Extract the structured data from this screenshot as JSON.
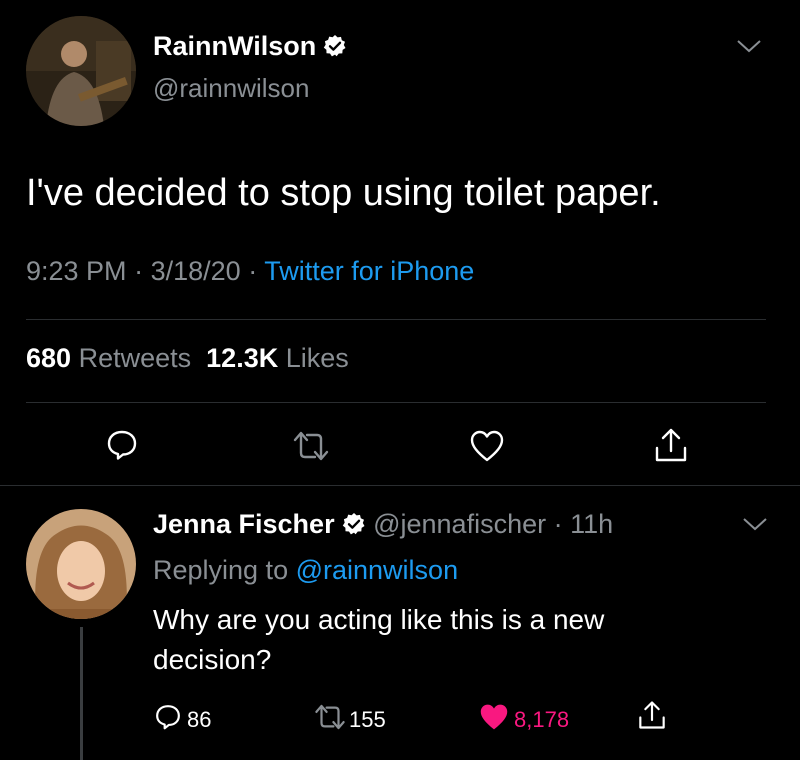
{
  "main_tweet": {
    "display_name": "RainnWilson",
    "handle": "@rainnwilson",
    "text": "I've decided to stop using toilet paper.",
    "time": "9:23 PM",
    "date": "3/18/20",
    "source": "Twitter for iPhone",
    "retweets_count": "680",
    "retweets_label": "Retweets",
    "likes_count": "12.3K",
    "likes_label": "Likes",
    "separator": "·"
  },
  "reply": {
    "display_name": "Jenna Fischer",
    "handle": "@jennafischer",
    "age": "11h",
    "replying_to_label": "Replying to",
    "replying_to_handle": "@rainnwilson",
    "text_line1": "Why are you acting like this is a new",
    "text_line2": "decision?",
    "reply_count": "86",
    "retweet_count": "155",
    "like_count": "8,178",
    "separator": "·"
  },
  "colors": {
    "background": "#000000",
    "link_blue": "#1d9bf0",
    "verified_badge": "#ffffff",
    "liked_red": "#f91880",
    "muted_gray": "#8a8f94"
  },
  "icons": {
    "verified": "verified-badge-icon",
    "chevron": "chevron-down-icon",
    "reply": "reply-icon",
    "retweet": "retweet-icon",
    "like": "heart-icon",
    "share": "share-icon"
  }
}
